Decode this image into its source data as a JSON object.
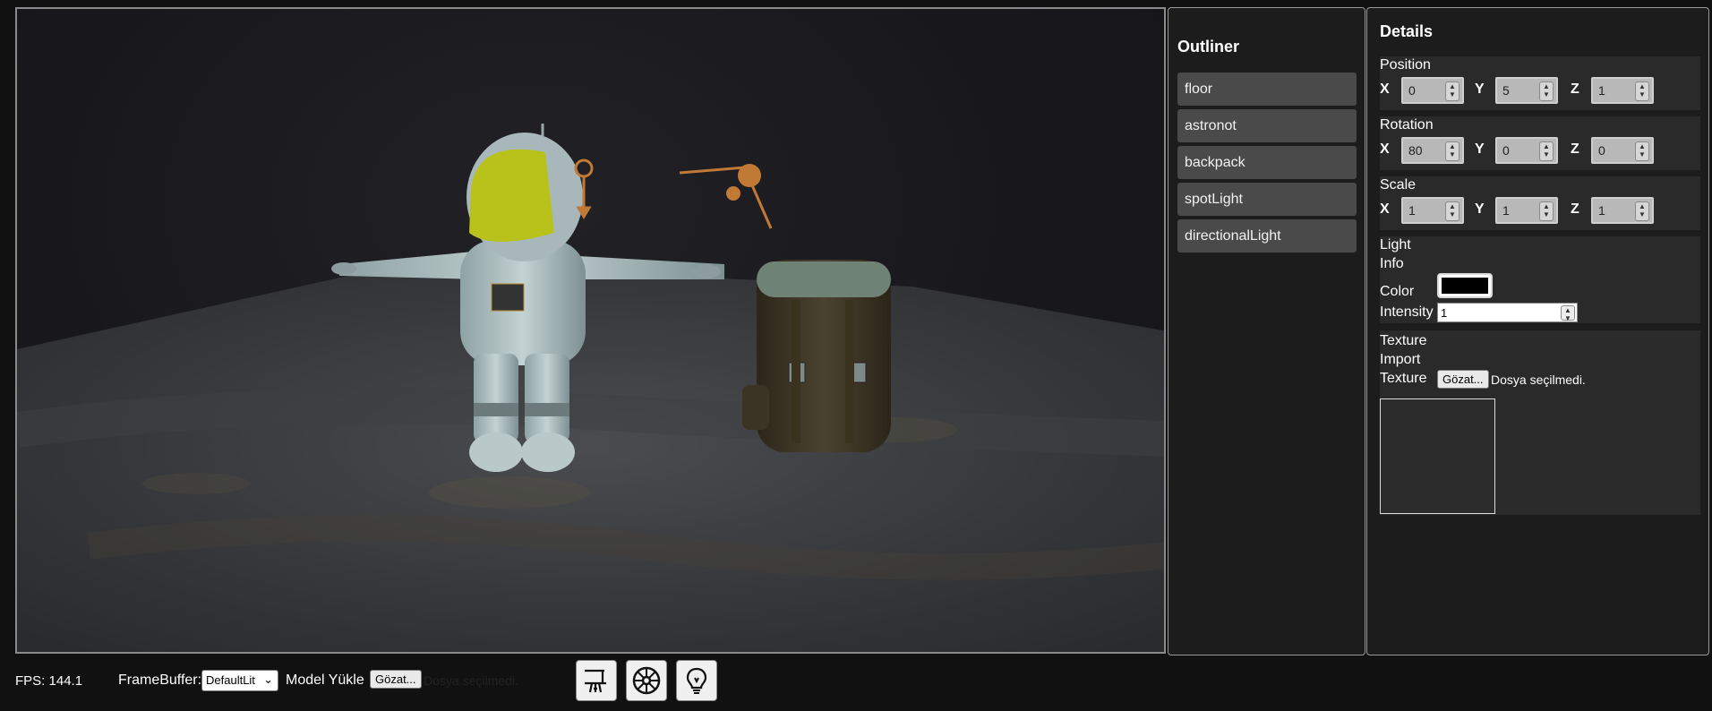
{
  "status": {
    "fps_label": "FPS: 144.1"
  },
  "framebuffer": {
    "label": "FrameBuffer:",
    "selected": "DefaultLit"
  },
  "model_upload": {
    "label": "Model Yükle",
    "button": "Gözat...",
    "file_status": "Dosya seçilmedi."
  },
  "toolbar": {
    "icons": [
      "transform-gizmo-icon",
      "wheel-icon",
      "lightbulb-icon"
    ]
  },
  "outliner": {
    "title": "Outliner",
    "items": [
      "floor",
      "astronot",
      "backpack",
      "spotLight",
      "directionalLight"
    ]
  },
  "details": {
    "title": "Details",
    "position": {
      "label": "Position",
      "x": "0",
      "y": "5",
      "z": "1"
    },
    "rotation": {
      "label": "Rotation",
      "x": "80",
      "y": "0",
      "z": "0"
    },
    "scale": {
      "label": "Scale",
      "x": "1",
      "y": "1",
      "z": "1"
    },
    "axes": {
      "x": "X",
      "y": "Y",
      "z": "Z"
    },
    "light_info": {
      "label_line1": "Light",
      "label_line2": "Info",
      "color_label": "Color",
      "color_value": "#000000",
      "intensity_label": "Intensity",
      "intensity_value": "1"
    },
    "texture_import": {
      "label_line1": "Texture",
      "label_line2": "Import",
      "texture_label": "Texture",
      "button": "Gözat...",
      "file_status": "Dosya seçilmedi."
    }
  },
  "colors": {
    "background": "#111111",
    "panel": "#1c1c1c",
    "section": "#2a2a2a",
    "outliner_item": "#4a4a4a",
    "gizmo": "#c07a35",
    "helmet_visor": "#b9c21a"
  }
}
